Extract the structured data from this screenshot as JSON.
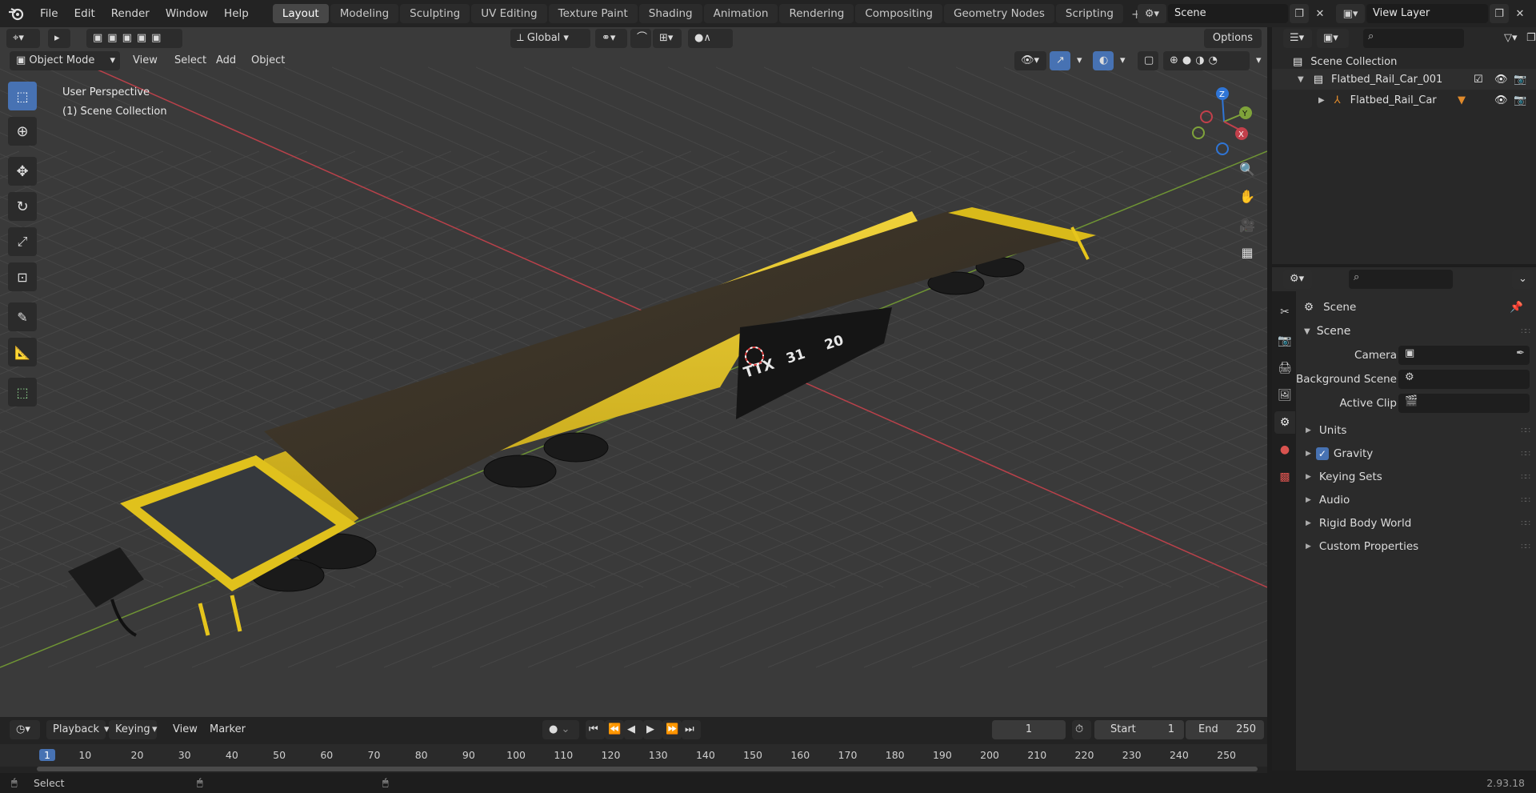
{
  "menu": {
    "items": [
      "File",
      "Edit",
      "Render",
      "Window",
      "Help"
    ]
  },
  "workspaces": [
    "Layout",
    "Modeling",
    "Sculpting",
    "UV Editing",
    "Texture Paint",
    "Shading",
    "Animation",
    "Rendering",
    "Compositing",
    "Geometry Nodes",
    "Scripting"
  ],
  "active_workspace": "Layout",
  "scene_field": "Scene",
  "view_layer_field": "View Layer",
  "viewport": {
    "mode": "Object Mode",
    "header_menus": [
      "View",
      "Select",
      "Add",
      "Object"
    ],
    "transform_orientation": "Global",
    "options_label": "Options",
    "overlay_line1": "User Perspective",
    "overlay_line2": "(1) Scene Collection",
    "gizmo_labels": {
      "z": "Z",
      "y": "Y",
      "x": "X"
    },
    "model_text": {
      "logo": "TTX",
      "num1": "31",
      "num2": "20"
    }
  },
  "outliner": {
    "root": "Scene Collection",
    "items": [
      {
        "label": "Flatbed_Rail_Car_001"
      },
      {
        "label": "Flatbed_Rail_Car"
      }
    ]
  },
  "properties": {
    "breadcrumb": "Scene",
    "panel_title": "Scene",
    "camera_label": "Camera",
    "background_scene_label": "Background Scene",
    "active_clip_label": "Active Clip",
    "sections": [
      "Units",
      "Gravity",
      "Keying Sets",
      "Audio",
      "Rigid Body World",
      "Custom Properties"
    ],
    "gravity_checked": true
  },
  "timeline": {
    "menus": [
      "Playback",
      "Keying",
      "View",
      "Marker"
    ],
    "current_frame": "1",
    "start_label": "Start",
    "start_value": "1",
    "end_label": "End",
    "end_value": "250",
    "ticks": [
      "1",
      "10",
      "20",
      "30",
      "40",
      "50",
      "60",
      "70",
      "80",
      "90",
      "100",
      "110",
      "120",
      "130",
      "140",
      "150",
      "160",
      "170",
      "180",
      "190",
      "200",
      "210",
      "220",
      "230",
      "240",
      "250"
    ]
  },
  "status": {
    "left": "Select",
    "version": "2.93.18"
  },
  "colors": {
    "accent": "#4772b3",
    "x_axis": "#c2404b",
    "y_axis": "#7fa33a",
    "z_axis": "#2f75d6",
    "car_yellow": "#e7c51a",
    "deck": "#3b3325"
  }
}
